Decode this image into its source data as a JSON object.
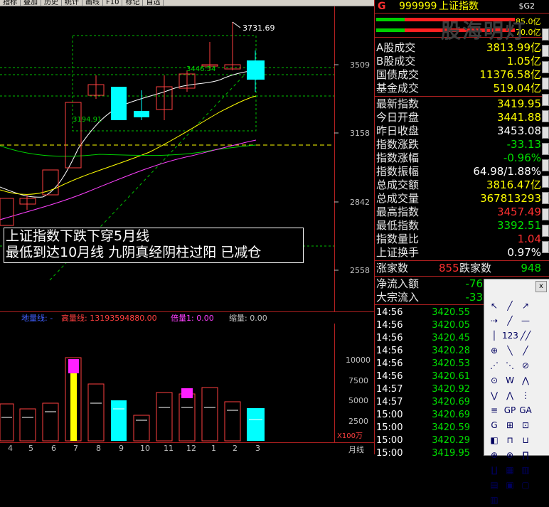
{
  "toolbar": {
    "items": [
      "指标",
      "叠加",
      "历史",
      "统计",
      "画线",
      "F10",
      "标记",
      "自选"
    ]
  },
  "price_axis": {
    "labels": [
      "3509",
      "3158",
      "2842",
      "2558"
    ]
  },
  "candle_labels": {
    "peak": "3731.69",
    "mid": "3446.54",
    "low": "3194.91"
  },
  "annotation": {
    "line1": "上证指数下跌下穿5月线",
    "line2": "最低到达10月线 九阴真经阴柱过阳 已减仓"
  },
  "vol_info": {
    "dl_label": "地量线: -",
    "gl_label": "高量线: 13193594880.00",
    "bl_label": "倍量1: 0.00",
    "sl_label": "缩量: 0.00"
  },
  "vol_axis": {
    "labels": [
      "10000",
      "7500",
      "5000",
      "2500"
    ],
    "unit": "X100万"
  },
  "x_axis": {
    "labels": [
      "4",
      "5",
      "6",
      "7",
      "8",
      "9",
      "10",
      "11",
      "12",
      "1",
      "2",
      "3"
    ],
    "period": "月线"
  },
  "panel": {
    "title_code": "999999",
    "title_name": "上证指数",
    "title_prefix": "G",
    "title_right": "$G2",
    "watermark": "股海明灯",
    "bar_top_value": "85.0亿",
    "bar_bottom_value": "70.0亿",
    "turnover": [
      {
        "label": "A股成交",
        "value": "3813.99亿"
      },
      {
        "label": "B股成交",
        "value": "1.05亿"
      },
      {
        "label": "国债成交",
        "value": "11376.58亿"
      },
      {
        "label": "基金成交",
        "value": "519.04亿"
      }
    ],
    "stats": [
      {
        "label": "最新指数",
        "value": "3419.95",
        "color": "#ffff00"
      },
      {
        "label": "今日开盘",
        "value": "3441.88",
        "color": "#ffff00"
      },
      {
        "label": "昨日收盘",
        "value": "3453.08",
        "color": "#ffffff"
      },
      {
        "label": "指数涨跌",
        "value": "-33.13",
        "color": "#00e000"
      },
      {
        "label": "指数涨幅",
        "value": "-0.96%",
        "color": "#00e000"
      },
      {
        "label": "指数振幅",
        "value": "64.98/1.88%",
        "color": "#ffffff"
      },
      {
        "label": "总成交额",
        "value": "3816.47亿",
        "color": "#ffff00"
      },
      {
        "label": "总成交量",
        "value": "367813293",
        "color": "#ffff00"
      },
      {
        "label": "最高指数",
        "value": "3457.49",
        "color": "#ff3030"
      },
      {
        "label": "最低指数",
        "value": "3392.51",
        "color": "#00e000"
      },
      {
        "label": "指数量比",
        "value": "1.04",
        "color": "#ff3030"
      },
      {
        "label": "上证换手",
        "value": "0.97%",
        "color": "#ffffff"
      }
    ],
    "updown": {
      "up_label": "涨家数",
      "up_value": "855",
      "down_label": "跌家数",
      "down_value": "948"
    },
    "flows": [
      {
        "label": "净流入额",
        "value": "-76"
      },
      {
        "label": "大宗流入",
        "value": "-33"
      }
    ],
    "ticks": [
      {
        "time": "14:56",
        "price": "3420.55"
      },
      {
        "time": "14:56",
        "price": "3420.05"
      },
      {
        "time": "14:56",
        "price": "3420.45"
      },
      {
        "time": "14:56",
        "price": "3420.28"
      },
      {
        "time": "14:56",
        "price": "3420.53"
      },
      {
        "time": "14:56",
        "price": "3420.61"
      },
      {
        "time": "14:57",
        "price": "3420.92"
      },
      {
        "time": "14:57",
        "price": "3420.69"
      },
      {
        "time": "15:00",
        "price": "3420.69"
      },
      {
        "time": "15:00",
        "price": "3420.59"
      },
      {
        "time": "15:00",
        "price": "3420.29"
      },
      {
        "time": "15:00",
        "price": "3419.95"
      }
    ]
  },
  "drawing_tools": {
    "close": "x",
    "tools": [
      "↖",
      "╱",
      "↗",
      "⇢",
      "╱",
      "—",
      "│",
      "123",
      "╱╱",
      "⊕",
      "╲",
      "╱",
      "⋰",
      "⋱",
      "⊘",
      "⊙",
      "W",
      "⋀",
      "⋁",
      "⋀",
      "⋮",
      "≡",
      "GP",
      "GA",
      "G",
      "⊞",
      "⊡",
      "◧",
      "⊓",
      "⊔",
      "⊕",
      "⊗",
      "∏",
      "∐",
      "▦",
      "▥",
      "▤",
      "▣",
      "▢",
      "▥"
    ]
  }
}
